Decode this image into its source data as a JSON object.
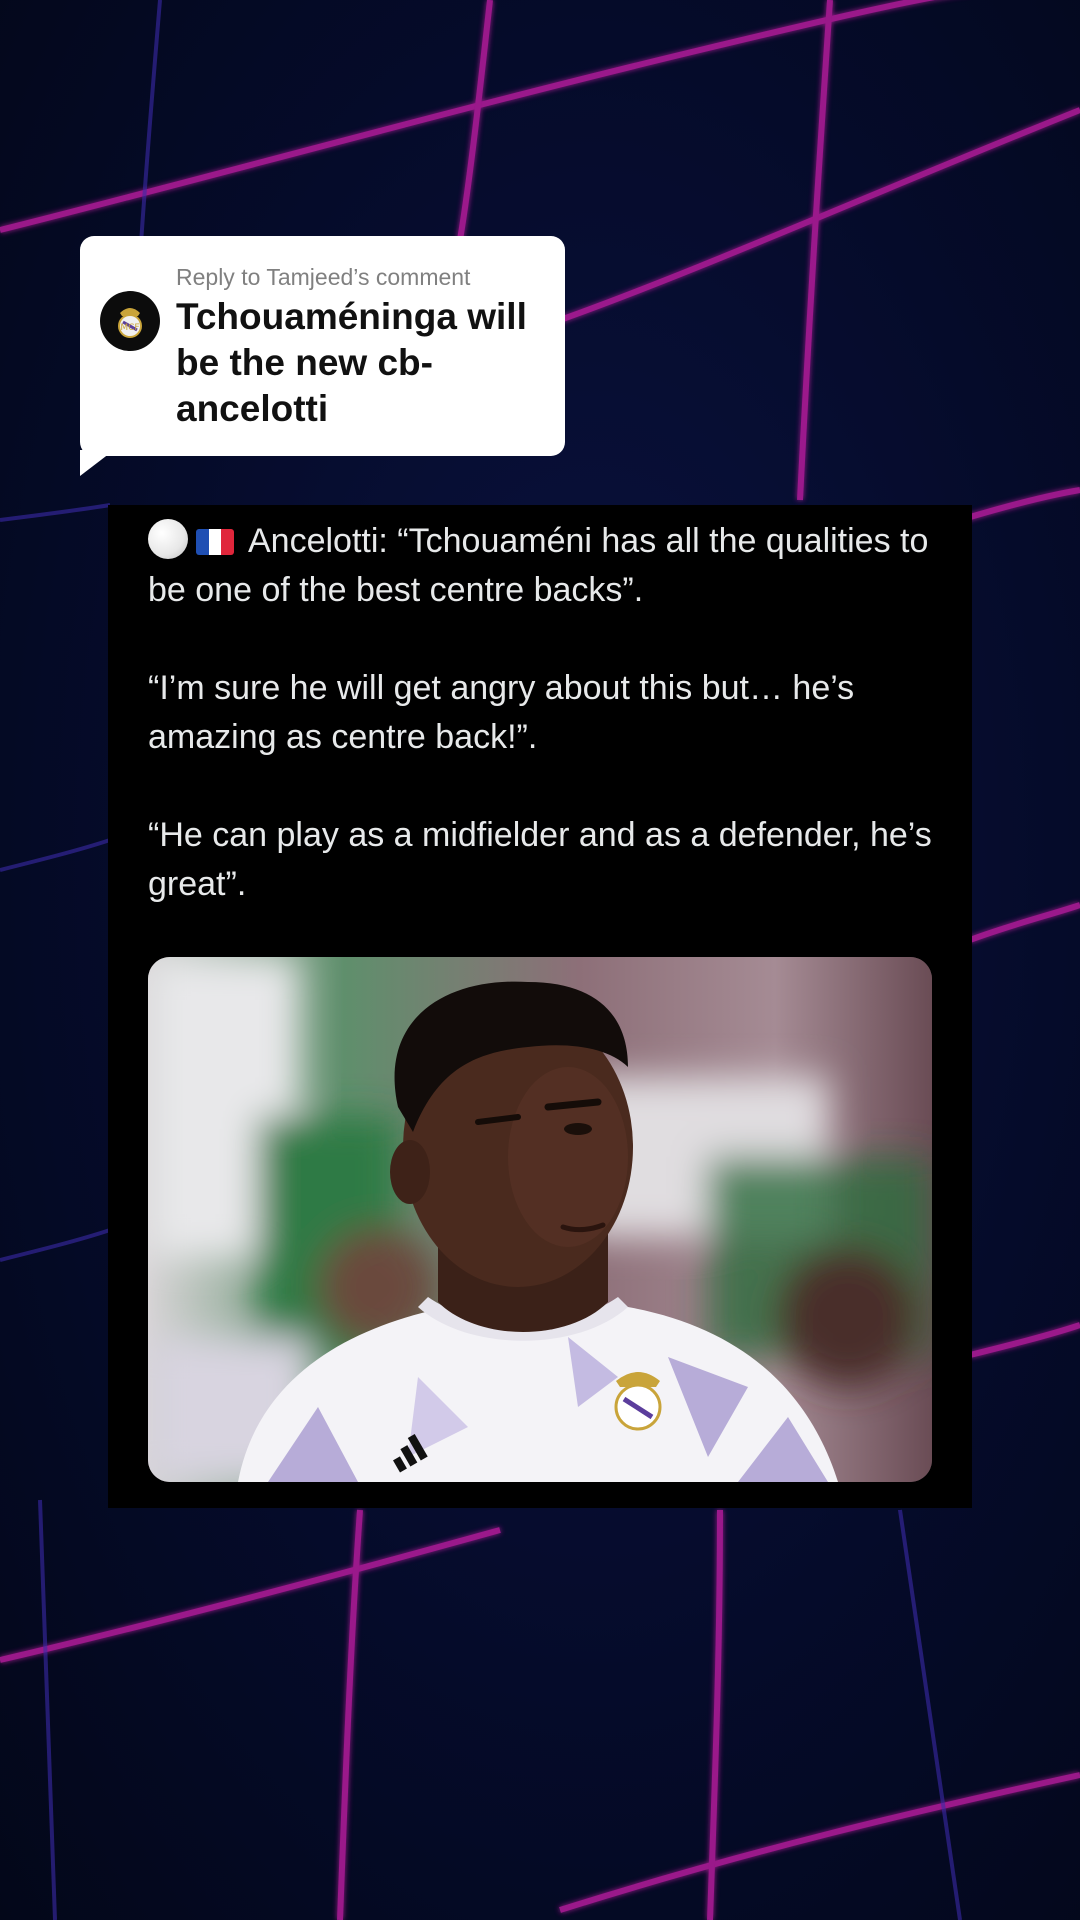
{
  "reply": {
    "header": "Reply to Tamjeed’s comment",
    "text": "Tchouaméninga will be the new cb-ancelotti",
    "avatar_icon": "real-madrid-crest-icon"
  },
  "tweet": {
    "line1": "Ancelotti: “Tchouaméni has all the qualities to be one of the best centre backs”.",
    "paragraph2": "“I’m sure he will get angry about this but… he’s amazing as centre back!”.",
    "paragraph3": "“He can play as a midfielder and as a defender, he’s great”.",
    "emoji_icons": [
      "white-circle-icon",
      "france-flag-icon"
    ],
    "image_icon": "player-photo"
  },
  "colors": {
    "background": "#050c2a",
    "net_lines": "#d21ea0",
    "card": "#000000",
    "bubble": "#ffffff"
  }
}
